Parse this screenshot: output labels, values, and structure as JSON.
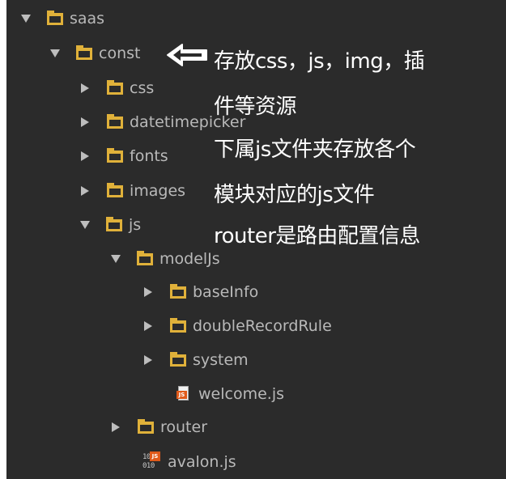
{
  "tree": {
    "items": [
      {
        "name": "saas",
        "type": "folder",
        "expanded": true
      },
      {
        "name": "const",
        "type": "folder",
        "expanded": true
      },
      {
        "name": "css",
        "type": "folder",
        "expanded": false
      },
      {
        "name": "datetimepicker",
        "type": "folder",
        "expanded": false
      },
      {
        "name": "fonts",
        "type": "folder",
        "expanded": false
      },
      {
        "name": "images",
        "type": "folder",
        "expanded": false
      },
      {
        "name": "js",
        "type": "folder",
        "expanded": true
      },
      {
        "name": "modelJs",
        "type": "folder",
        "expanded": true
      },
      {
        "name": "baseInfo",
        "type": "folder",
        "expanded": false
      },
      {
        "name": "doubleRecordRule",
        "type": "folder",
        "expanded": false
      },
      {
        "name": "system",
        "type": "folder",
        "expanded": false
      },
      {
        "name": "welcome.js",
        "type": "js-file"
      },
      {
        "name": "router",
        "type": "folder",
        "expanded": false
      },
      {
        "name": "avalon.js",
        "type": "minified-js-file"
      }
    ]
  },
  "annotations": {
    "line1": "存放css，js，img，插",
    "line2": "件等资源",
    "line3": "下属js文件夹存放各个",
    "line4": "模块对应的js文件",
    "line5": "router是路由配置信息"
  },
  "icons": {
    "folder": "folder-icon",
    "expand": "chevron-down-icon",
    "collapse": "chevron-right-icon",
    "js": "js-file-icon",
    "pointer": "left-arrow-pointer-icon"
  },
  "colors": {
    "background": "#2b2b2b",
    "folder": "#e0b13a",
    "text": "#b9b9b9",
    "annotation": "#ffffff",
    "js_badge": "#e05a1a"
  }
}
